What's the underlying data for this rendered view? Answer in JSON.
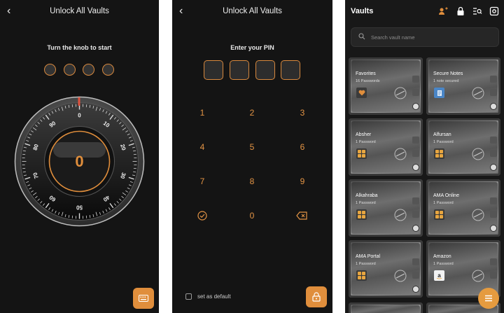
{
  "knob_screen": {
    "title": "Unlock All Vaults",
    "hint": "Turn the knob to start",
    "dial_value": "0",
    "dial_labels": [
      "0",
      "10",
      "20",
      "30",
      "40",
      "50",
      "60",
      "70",
      "80",
      "90"
    ]
  },
  "pin_screen": {
    "title": "Unlock All Vaults",
    "hint": "Enter your PIN",
    "keys": [
      "1",
      "2",
      "3",
      "4",
      "5",
      "6",
      "7",
      "8",
      "9",
      "0"
    ],
    "default_label": "set as default"
  },
  "vaults_screen": {
    "title": "Vaults",
    "search_placeholder": "Search vault name",
    "vaults": [
      {
        "name": "Favorites",
        "count": "16 Passwords",
        "icon": "heart-icon"
      },
      {
        "name": "Secure Notes",
        "count": "1 note secured",
        "icon": "notes-icon"
      },
      {
        "name": "Absher",
        "count": "1 Password",
        "icon": "grid-icon"
      },
      {
        "name": "Alfursan",
        "count": "1 Password",
        "icon": "grid-icon"
      },
      {
        "name": "Alkahraba",
        "count": "1 Password",
        "icon": "grid-icon"
      },
      {
        "name": "AMA Online",
        "count": "1 Password",
        "icon": "grid-icon"
      },
      {
        "name": "AMA Portal",
        "count": "1 Password",
        "icon": "grid-icon"
      },
      {
        "name": "Amazon",
        "count": "1 Password",
        "icon": "amazon-icon"
      }
    ]
  },
  "colors": {
    "accent": "#e08e3c",
    "background": "#141414"
  }
}
